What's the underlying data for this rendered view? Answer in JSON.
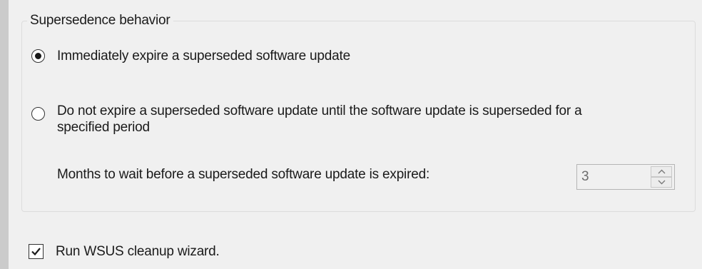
{
  "supersedence": {
    "legend": "Supersedence behavior",
    "options": [
      {
        "label": "Immediately expire a superseded software update",
        "selected": true
      },
      {
        "label_line1": "Do not expire a superseded software update until the software update is superseded for a",
        "label_line2": "specified period",
        "selected": false
      }
    ],
    "months_label": "Months to wait before a superseded software update is expired:",
    "months_value": "3"
  },
  "cleanup": {
    "label": "Run WSUS cleanup wizard.",
    "checked": true
  }
}
